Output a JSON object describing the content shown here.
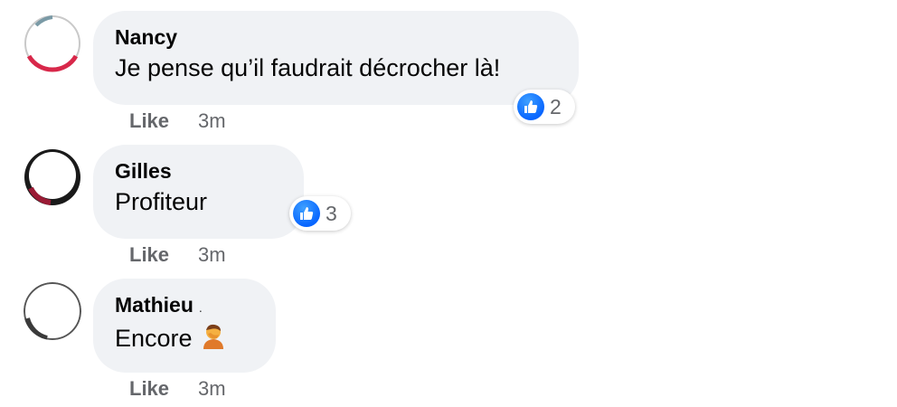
{
  "colors": {
    "bubble": "#f0f2f5",
    "like_blue": "#0866ff",
    "meta_gray": "#65676b"
  },
  "icons": {
    "reaction": "thumbs-up-icon",
    "emoji": "face-palm-emoji"
  },
  "comments": [
    {
      "author": "Nancy",
      "text": "Je pense qu’il faudrait décrocher là!",
      "reaction_count": "2",
      "like_label": "Like",
      "time": "3m"
    },
    {
      "author": "Gilles",
      "text": "Profiteur",
      "reaction_count": "3",
      "like_label": "Like",
      "time": "3m"
    },
    {
      "author": "Mathieu",
      "author_suffix": ".",
      "text": "Encore",
      "like_label": "Like",
      "time": "3m"
    }
  ]
}
